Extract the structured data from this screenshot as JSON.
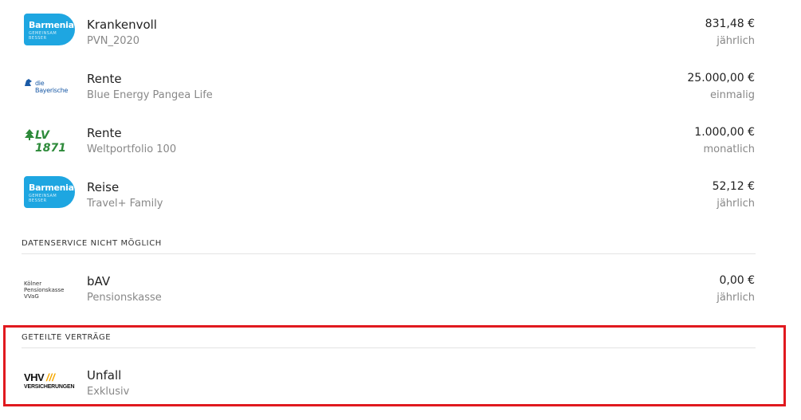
{
  "contracts": [
    {
      "logo": "barmenia",
      "logo_text_1": "Barmenia",
      "logo_text_2": "GEMEINSAM BESSER",
      "title": "Krankenvoll",
      "subtitle": "PVN_2020",
      "amount": "831,48 €",
      "frequency": "jährlich"
    },
    {
      "logo": "die-bayerische",
      "logo_text_1": "die Bayerische",
      "title": "Rente",
      "subtitle": "Blue Energy Pangea Life",
      "amount": "25.000,00 €",
      "frequency": "einmalig"
    },
    {
      "logo": "lv1871",
      "logo_text_1": "LV 1871",
      "title": "Rente",
      "subtitle": "Weltportfolio 100",
      "amount": "1.000,00 €",
      "frequency": "monatlich"
    },
    {
      "logo": "barmenia",
      "logo_text_1": "Barmenia",
      "logo_text_2": "GEMEINSAM BESSER",
      "title": "Reise",
      "subtitle": "Travel+ Family",
      "amount": "52,12 €",
      "frequency": "jährlich"
    }
  ],
  "section_no_service": {
    "header": "DATENSERVICE NICHT MÖGLICH",
    "items": [
      {
        "logo": "koelner-pensionskasse",
        "logo_text_1": "Kölner Pensionskasse VVaG",
        "title": "bAV",
        "subtitle": "Pensionskasse",
        "amount": "0,00 €",
        "frequency": "jährlich"
      }
    ]
  },
  "section_shared": {
    "header": "GETEILTE VERTRÄGE",
    "items": [
      {
        "logo": "vhv",
        "logo_text_1": "VHV",
        "logo_text_2": "///",
        "logo_text_3": "VERSICHERUNGEN",
        "title": "Unfall",
        "subtitle": "Exklusiv"
      }
    ]
  },
  "colors": {
    "barmenia": "#1ea6e1",
    "lv_green": "#2d8a3a",
    "vhv_accent": "#f6a800",
    "highlight": "#e0191f"
  }
}
